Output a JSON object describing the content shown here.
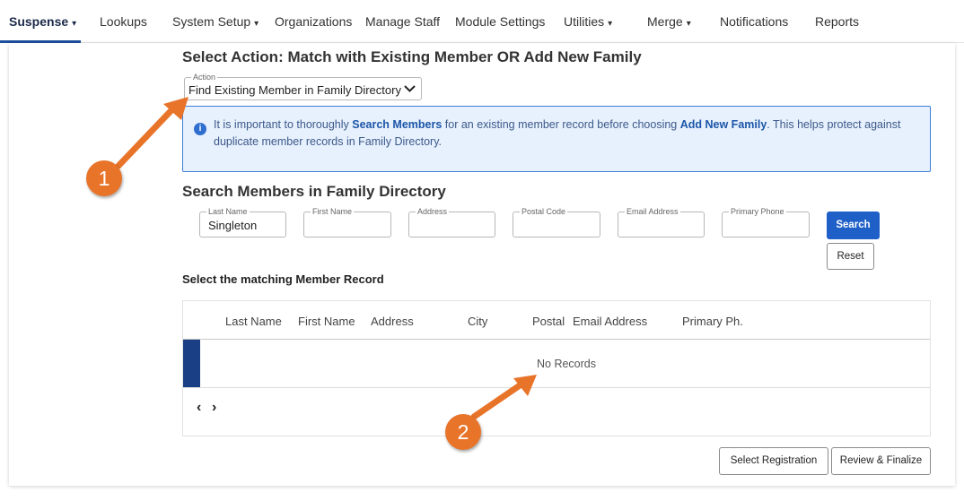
{
  "nav": {
    "items": [
      {
        "label": "Suspense",
        "caret": "▾"
      },
      {
        "label": "Lookups",
        "caret": ""
      },
      {
        "label": "System Setup",
        "caret": "▾"
      },
      {
        "label": "Organizations",
        "caret": ""
      },
      {
        "label": "Manage Staff",
        "caret": ""
      },
      {
        "label": "Module Settings",
        "caret": ""
      },
      {
        "label": "Utilities",
        "caret": "▾"
      },
      {
        "label": "Merge",
        "caret": "▾"
      },
      {
        "label": "Notifications",
        "caret": ""
      },
      {
        "label": "Reports",
        "caret": ""
      }
    ]
  },
  "action_section": {
    "title": "Select Action: Match with Existing Member OR Add New Family",
    "select_legend": "Action",
    "select_value": "Find Existing Member in Family Directory"
  },
  "info": {
    "part1": "It is important to thoroughly ",
    "link1": "Search Members",
    "part2": " for an existing member record before choosing ",
    "link2": "Add New Family",
    "part3": ". This helps protect against duplicate member records in Family Directory."
  },
  "search": {
    "title": "Search Members in Family Directory",
    "fields": [
      {
        "legend": "Last Name",
        "value": "Singleton"
      },
      {
        "legend": "First Name",
        "value": ""
      },
      {
        "legend": "Address",
        "value": ""
      },
      {
        "legend": "Postal Code",
        "value": ""
      },
      {
        "legend": "Email Address",
        "value": ""
      },
      {
        "legend": "Primary Phone",
        "value": ""
      }
    ],
    "search_label": "Search",
    "reset_label": "Reset"
  },
  "results": {
    "title": "Select the matching Member Record",
    "columns": [
      "Last Name",
      "First Name",
      "Address",
      "City",
      "Postal",
      "Email Address",
      "Primary Ph."
    ],
    "empty_text": "No Records",
    "prev_glyph": "‹",
    "next_glyph": "›"
  },
  "footer": {
    "select_registration_label": "Select Registration",
    "review_finalize_label": "Review & Finalize"
  },
  "annotations": [
    {
      "number": "1"
    },
    {
      "number": "2"
    }
  ],
  "colors": {
    "accent": "#1f5fc8",
    "annotation": "#e8742a",
    "info_bg": "#e7f0fd"
  }
}
